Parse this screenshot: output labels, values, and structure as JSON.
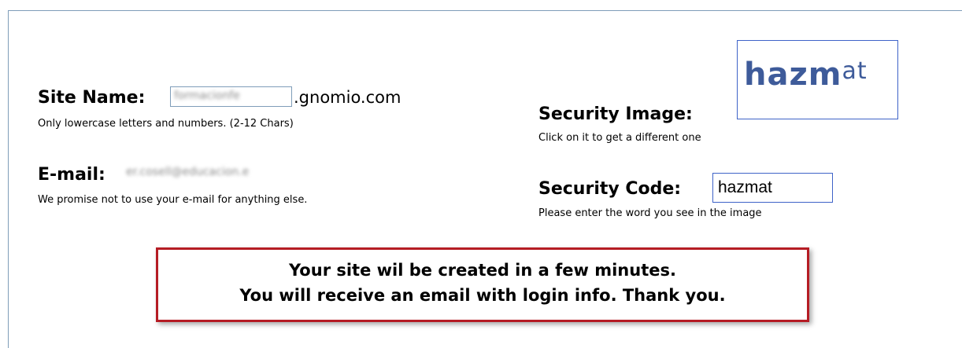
{
  "site_name": {
    "label": "Site Name:",
    "value": "formacionfe",
    "domain_suffix": ".gnomio.com",
    "hint": "Only lowercase letters and numbers. (2-12 Chars)"
  },
  "email": {
    "label": "E-mail:",
    "value": "er.cosell@educacion.e",
    "hint": "We promise not to use your e-mail for anything else."
  },
  "security_image": {
    "label": "Security Image:",
    "captcha_part1": "hazm",
    "captcha_part2": "at",
    "hint": "Click on it to get a different one"
  },
  "security_code": {
    "label": "Security Code:",
    "value": "hazmat",
    "hint": "Please enter the word you see in the image"
  },
  "notice": {
    "line1": "Your site wil be created in a few minutes.",
    "line2": "You will receive an email with login info. Thank you."
  }
}
